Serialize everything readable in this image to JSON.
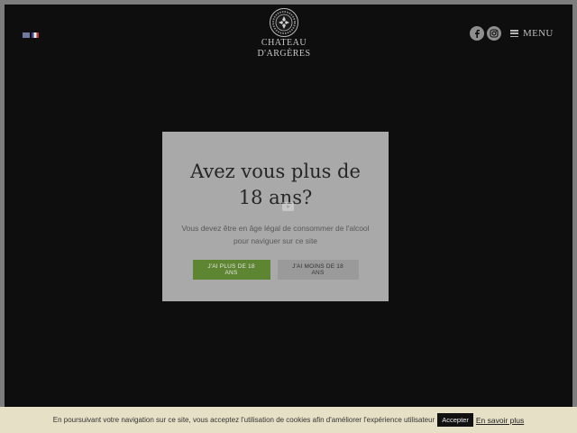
{
  "header": {
    "languages": [
      "en",
      "fr"
    ],
    "logo_lines": [
      "CHATEAU",
      "D'ARGÈRES"
    ],
    "social_icons": [
      "facebook-icon",
      "instagram-icon"
    ],
    "menu_label": "MENU"
  },
  "age_gate": {
    "title_line1": "Avez vous plus de",
    "title_line2": "18 ans?",
    "text": "Vous devez être en âge légal de consommer de l'alcool pour naviguer sur ce site",
    "yes_label": "J'AI PLUS DE 18 ANS",
    "no_label": "J'AI MOINS DE 18 ANS",
    "yes_color": "#5e8531"
  },
  "cookie_bar": {
    "text": "En poursuivant votre navigation sur ce site, vous acceptez l'utilisation de cookies afin d'améliorer l'expérience utilisateur",
    "accept_label": "Accepter",
    "more_label": "En savoir plus"
  }
}
